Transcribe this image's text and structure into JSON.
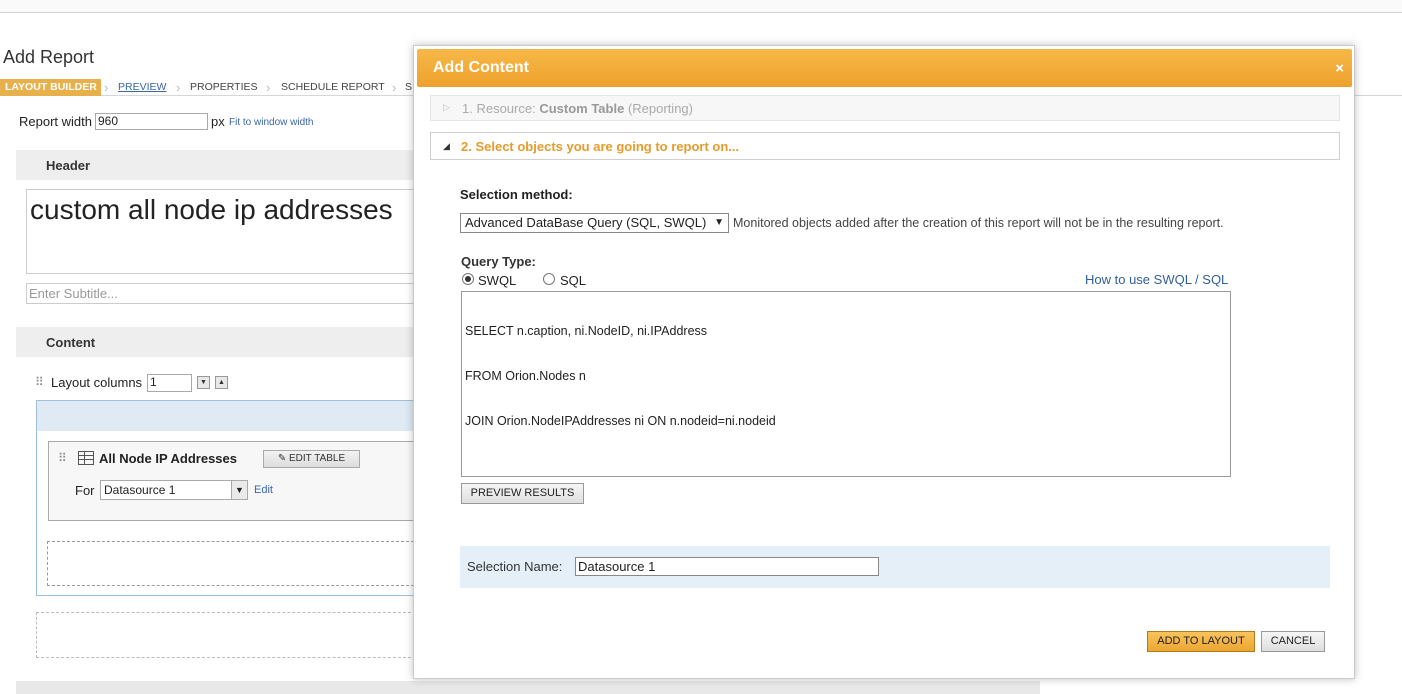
{
  "page": {
    "title": "Add Report",
    "breadcrumbs": [
      "LAYOUT BUILDER",
      "PREVIEW",
      "PROPERTIES",
      "SCHEDULE REPORT",
      "S"
    ],
    "report_width_label": "Report width",
    "report_width_value": "960",
    "report_width_unit": "px",
    "fit_link": "Fit to window width",
    "header_section": "Header",
    "header_title": "custom all node ip addresses",
    "subtitle_placeholder": "Enter Subtitle...",
    "content_section": "Content",
    "layout_columns_label": "Layout columns",
    "layout_columns_value": "1",
    "table_title": "All Node IP Addresses",
    "edit_table_label": "EDIT TABLE",
    "for_label": "For",
    "datasource_value": "Datasource 1",
    "edit_link": "Edit"
  },
  "dialog": {
    "title": "Add Content",
    "close": "×",
    "step1_prefix": "1. Resource:",
    "step1_value": "Custom Table",
    "step1_suffix": "(Reporting)",
    "step2_label": "2. Select objects you are going to report on...",
    "selection_method_label": "Selection method:",
    "selection_method_value": "Advanced DataBase Query (SQL, SWQL)",
    "selection_note": "Monitored objects added after the creation of this report will not be in the resulting report.",
    "query_type_label": "Query Type:",
    "query_types": [
      "SWQL",
      "SQL"
    ],
    "selected_query_type": "SWQL",
    "howto_link": "How to use SWQL / SQL",
    "query_lines": [
      "SELECT n.caption, ni.NodeID, ni.IPAddress",
      "FROM Orion.Nodes n",
      "JOIN Orion.NodeIPAddresses ni ON n.nodeid=ni.nodeid"
    ],
    "preview_button": "PREVIEW RESULTS",
    "selection_name_label": "Selection Name:",
    "selection_name_value": "Datasource 1",
    "add_button": "ADD TO LAYOUT",
    "cancel_button": "CANCEL",
    "colors": {
      "title_bar": "#f0a732",
      "accent_text": "#e69b2a",
      "link": "#2f5f9c"
    }
  }
}
